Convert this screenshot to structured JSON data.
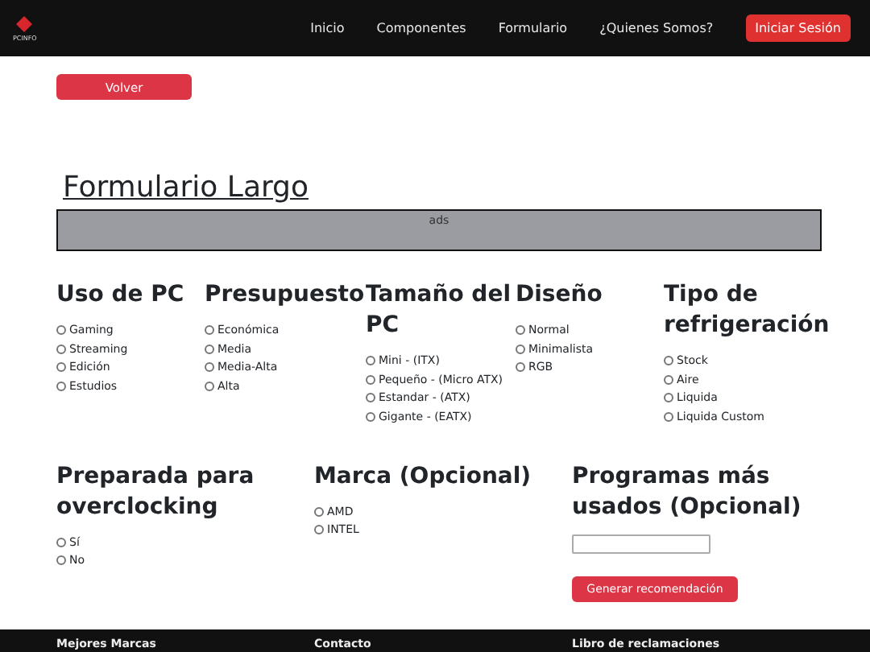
{
  "navbar": {
    "logo_text": "PCINFO",
    "links": [
      {
        "label": "Inicio"
      },
      {
        "label": "Componentes"
      },
      {
        "label": "Formulario"
      },
      {
        "label": "¿Quienes Somos?"
      }
    ],
    "login_button": "Iniciar Sesión"
  },
  "back_button": "Volver",
  "title": "Formulario Largo",
  "ads": "ads",
  "groups_row_1": [
    {
      "heading": "Uso de PC",
      "options": [
        {
          "label": "Gaming",
          "selected": false
        },
        {
          "label": "Streaming",
          "selected": false
        },
        {
          "label": "Edición",
          "selected": false
        },
        {
          "label": "Estudios",
          "selected": false
        }
      ]
    },
    {
      "heading": "Presupuesto",
      "options": [
        {
          "label": "Económica",
          "selected": false
        },
        {
          "label": "Media",
          "selected": false
        },
        {
          "label": "Media-Alta",
          "selected": false
        },
        {
          "label": "Alta",
          "selected": false
        }
      ]
    },
    {
      "heading": "Tamaño del PC",
      "options": [
        {
          "label": "Mini - (ITX)",
          "selected": false
        },
        {
          "label": "Pequeño - (Micro ATX)",
          "selected": false
        },
        {
          "label": "Estandar - (ATX)",
          "selected": false
        },
        {
          "label": "Gigante - (EATX)",
          "selected": false
        }
      ]
    },
    {
      "heading": "Diseño",
      "options": [
        {
          "label": "Normal",
          "selected": false
        },
        {
          "label": "Minimalista",
          "selected": false
        },
        {
          "label": "RGB",
          "selected": false
        }
      ]
    },
    {
      "heading": "Tipo de refrigeración",
      "options": [
        {
          "label": "Stock",
          "selected": false
        },
        {
          "label": "Aire",
          "selected": false
        },
        {
          "label": "Liquida",
          "selected": false
        },
        {
          "label": "Liquida Custom",
          "selected": false
        }
      ]
    }
  ],
  "groups_row_2": [
    {
      "heading": "Preparada para overclocking",
      "options": [
        {
          "label": "Sí",
          "selected": false
        },
        {
          "label": "No",
          "selected": false
        }
      ]
    },
    {
      "heading": "Marca (Opcional)",
      "options": [
        {
          "label": "AMD",
          "selected": false
        },
        {
          "label": "INTEL",
          "selected": false
        }
      ]
    }
  ],
  "programs": {
    "heading": "Programas más usados (Opcional)",
    "submit_button": "Generar recomendación"
  },
  "footer": {
    "columns": [
      "Mejores Marcas",
      "Contacto",
      "Libro de reclamaciones"
    ]
  }
}
